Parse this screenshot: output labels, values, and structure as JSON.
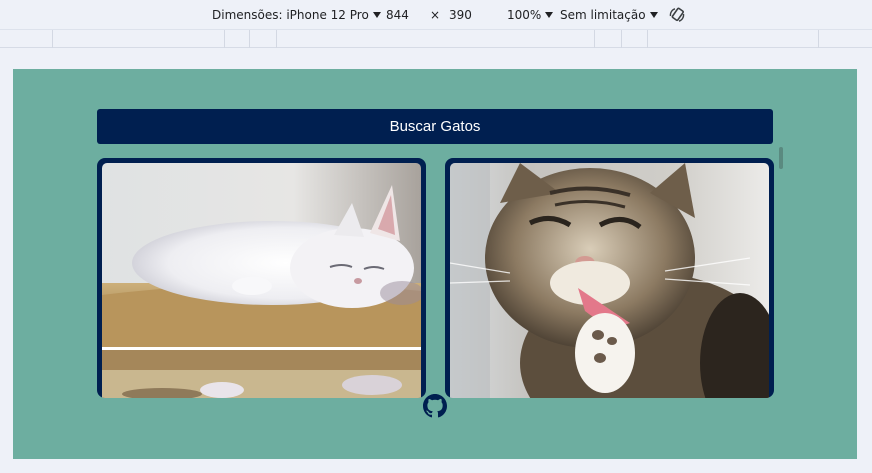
{
  "devtools": {
    "dimensions_label": "Dimensões: iPhone 12 Pro",
    "width": "844",
    "times": "×",
    "height": "390",
    "zoom": "100%",
    "throttle": "Sem limitação",
    "rotate_icon": "rotate-icon"
  },
  "page": {
    "search_button": "Buscar Gatos",
    "cards": [
      {
        "image": "sleeping-white-kitten-photo",
        "next_image": "cat-photo"
      },
      {
        "image": "tabby-cat-licking-paw-photo"
      }
    ],
    "footer_icon": "github-icon"
  },
  "colors": {
    "background": "#6daea0",
    "primary": "#001f50",
    "toolbar": "#eef1f8"
  }
}
